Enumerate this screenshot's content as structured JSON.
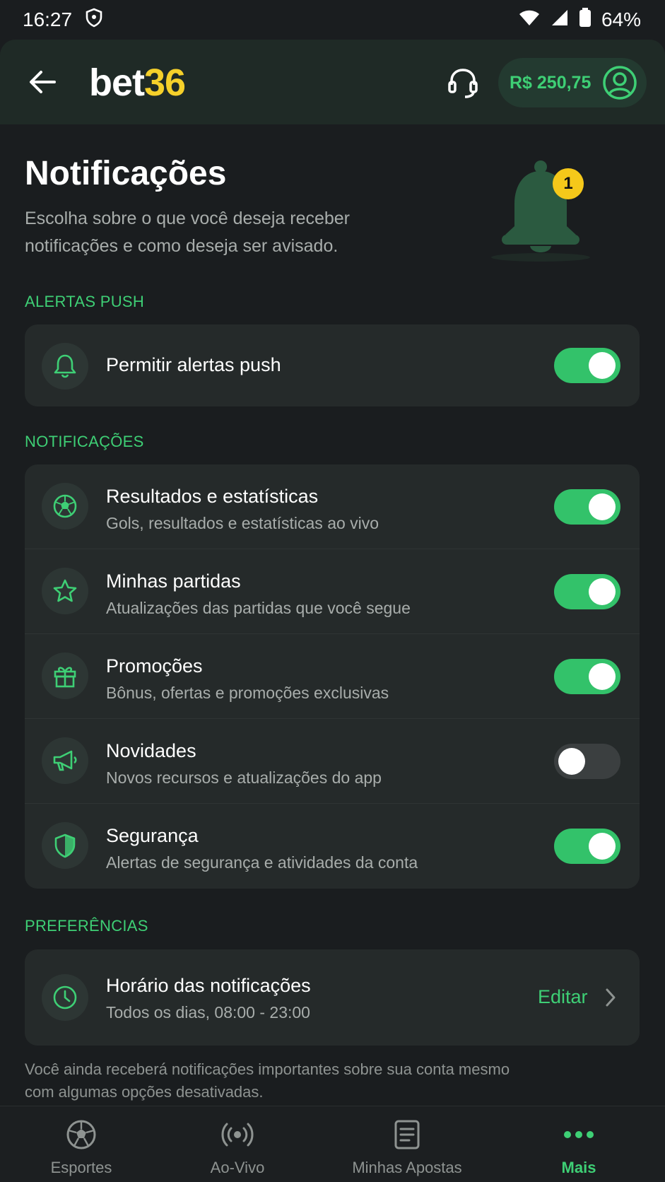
{
  "status_bar": {
    "time": "16:27",
    "battery": "64%"
  },
  "header": {
    "logo_white": "bet",
    "logo_yellow": "36",
    "balance": "R$ 250,75"
  },
  "page": {
    "title": "Notificações",
    "subtitle": "Escolha sobre o que você deseja receber notificações e como deseja ser avisado.",
    "bell_badge": "1"
  },
  "sections": {
    "push": "ALERTAS PUSH",
    "notifications": "NOTIFICAÇÕES",
    "preferences": "PREFERÊNCIAS"
  },
  "push": {
    "label": "Permitir alertas push",
    "enabled": true
  },
  "notifications": [
    {
      "title": "Resultados e estatísticas",
      "desc": "Gols, resultados e estatísticas ao vivo",
      "icon": "soccer-ball-icon",
      "enabled": true
    },
    {
      "title": "Minhas partidas",
      "desc": "Atualizações das partidas que você segue",
      "icon": "star-icon",
      "enabled": true
    },
    {
      "title": "Promoções",
      "desc": "Bônus, ofertas e promoções exclusivas",
      "icon": "gift-icon",
      "enabled": true
    },
    {
      "title": "Novidades",
      "desc": "Novos recursos e atualizações do app",
      "icon": "megaphone-icon",
      "enabled": false
    },
    {
      "title": "Segurança",
      "desc": "Alertas de segurança e atividades da conta",
      "icon": "shield-icon",
      "enabled": true
    }
  ],
  "preferences": {
    "schedule_title": "Horário das notificações",
    "schedule_value": "Todos os dias, 08:00 - 23:00",
    "edit_label": "Editar"
  },
  "footnote": "Você ainda receberá notificações importantes sobre sua conta mesmo com algumas opções desativadas.",
  "bottom_nav": [
    {
      "label": "Esportes",
      "icon": "soccer-ball-icon",
      "active": false
    },
    {
      "label": "Ao-Vivo",
      "icon": "live-broadcast-icon",
      "active": false
    },
    {
      "label": "Minhas Apostas",
      "icon": "bet-slip-icon",
      "active": false
    },
    {
      "label": "Mais",
      "icon": "more-dots-icon",
      "active": true
    }
  ],
  "colors": {
    "accent": "#3ecf75",
    "brand_yellow": "#f5d02a",
    "background": "#1a1d1f",
    "card": "#252a2a"
  }
}
